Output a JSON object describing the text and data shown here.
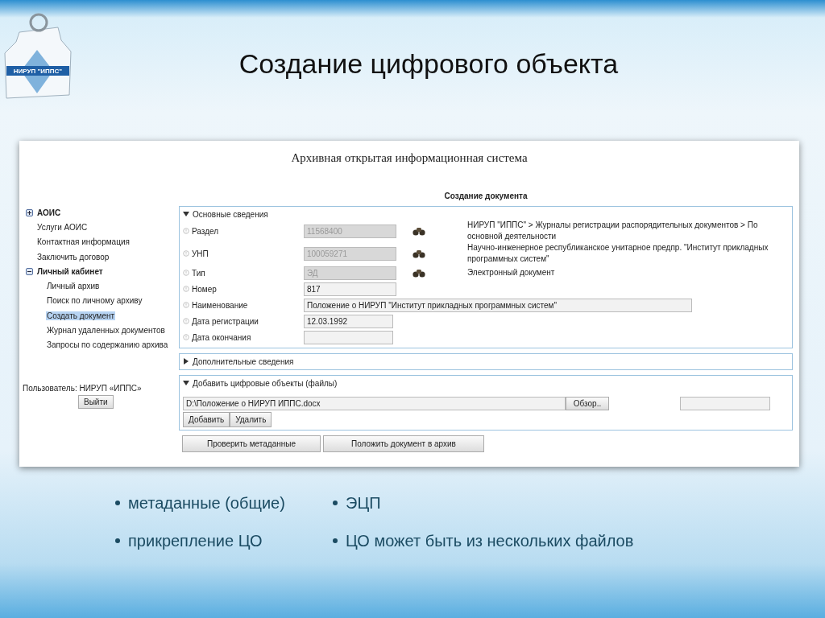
{
  "logo_text": "НИРУП \"ИППС\"",
  "title": "Создание цифрового объекта",
  "app": {
    "header": "Архивная открытая информационная система",
    "sidebar": {
      "items": [
        {
          "label": "АОИС",
          "expanded": false,
          "selected": false
        },
        {
          "label": "Услуги АОИС",
          "selected": false
        },
        {
          "label": "Контактная информация",
          "selected": false
        },
        {
          "label": "Заключить договор",
          "selected": false
        },
        {
          "label": "Личный кабинет",
          "expanded": true,
          "selected": false,
          "children": [
            {
              "label": "Личный архив",
              "selected": false
            },
            {
              "label": "Поиск по личному архиву",
              "selected": false
            },
            {
              "label": "Создать документ",
              "selected": true
            },
            {
              "label": "Журнал удаленных документов",
              "selected": false
            },
            {
              "label": "Запросы по содержанию архива",
              "selected": false
            }
          ]
        }
      ],
      "user": "Пользователь: НИРУП «ИППС»",
      "logout": "Выйти"
    },
    "main": {
      "title": "Создание документа",
      "sections": [
        {
          "title": "Основные сведения",
          "expanded": true,
          "kind": "fields",
          "fields": [
            {
              "label": "Раздел",
              "value": "11568400",
              "kind": "code",
              "disabled": true,
              "lookup": true,
              "description": "НИРУП \"ИППС\" > Журналы регистрации распорядительных документов > По основной деятельности"
            },
            {
              "label": "УНП",
              "value": "100059271",
              "kind": "code",
              "disabled": true,
              "lookup": true,
              "description": "Научно-инженерное республиканское унитарное предпр. \"Институт прикладных программных систем\""
            },
            {
              "label": "Тип",
              "value": "ЭД",
              "kind": "code",
              "disabled": true,
              "lookup": true,
              "description": "Электронный документ"
            },
            {
              "label": "Номер",
              "value": "817",
              "kind": "code",
              "disabled": false,
              "lookup": false
            },
            {
              "label": "Наименование",
              "value": "Положение о НИРУП \"Институт прикладных программных систем\"",
              "kind": "wide",
              "disabled": false,
              "lookup": false
            },
            {
              "label": "Дата регистрации",
              "value": "12.03.1992",
              "kind": "date",
              "disabled": false,
              "lookup": false
            },
            {
              "label": "Дата окончания",
              "kind": "date",
              "disabled": false,
              "lookup": false
            }
          ]
        },
        {
          "title": "Дополнительные сведения",
          "expanded": false
        },
        {
          "title": "Добавить цифровые объекты (файлы)",
          "expanded": true,
          "kind": "files",
          "file_path": "D:\\Положение о НИРУП ИППС.docx",
          "browse": "Обзор..",
          "buttons": [
            "Добавить",
            "Удалить"
          ]
        }
      ],
      "actions": [
        "Проверить метаданные",
        "Положить документ в архив"
      ]
    }
  },
  "bullets": [
    [
      "метаданные (общие)",
      "прикрепление ЦО"
    ],
    [
      "ЭЦП",
      "ЦО может быть из нескольких файлов"
    ]
  ]
}
